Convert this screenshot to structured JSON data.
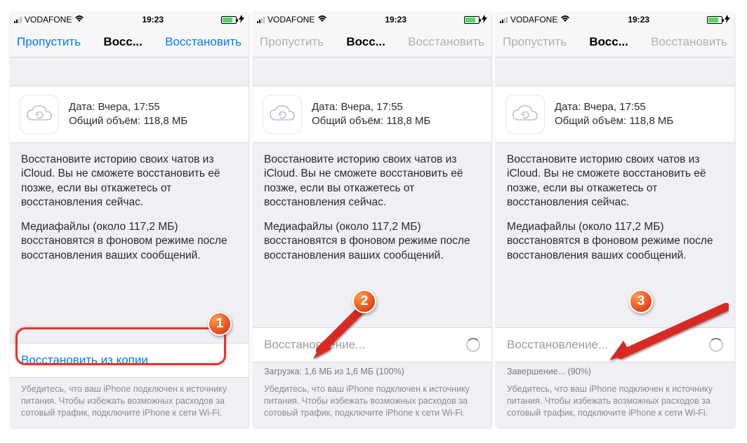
{
  "status": {
    "carrier": "VODAFONE",
    "time": "19:23",
    "wifi_icon": "wifi-icon",
    "battery_icon": "battery-icon",
    "charging_icon": "bolt-icon"
  },
  "nav": {
    "skip": "Пропустить",
    "title": "Восс...",
    "restore": "Восстановить"
  },
  "backup": {
    "date_label": "Дата: Вчера, 17:55",
    "size_label": "Общий объём: 118,8 МБ",
    "cloud_icon": "cloud-refresh-icon"
  },
  "body": {
    "p1": "Восстановите историю своих чатов из iCloud. Вы не сможете восстановить её позже, если вы откажетесь от восстановления сейчас.",
    "p2": "Медиафайлы (около 117,2 МБ) восстановятся в фоновом режиме после восстановления ваших сообщений."
  },
  "actions": {
    "restore_from_copy": "Восстановить из копии",
    "restoring": "Восстановление...",
    "download_progress": "Загрузка: 1,6 МБ из 1,6 МБ (100%)",
    "finishing_progress": "Завершение... (90%)"
  },
  "footnote": "Убедитесь, что ваш iPhone подключен к источнику питания. Чтобы избежать возможных расходов за сотовый трафик, подключите iPhone к сети Wi-Fi.",
  "steps": {
    "s1": "1",
    "s2": "2",
    "s3": "3"
  }
}
